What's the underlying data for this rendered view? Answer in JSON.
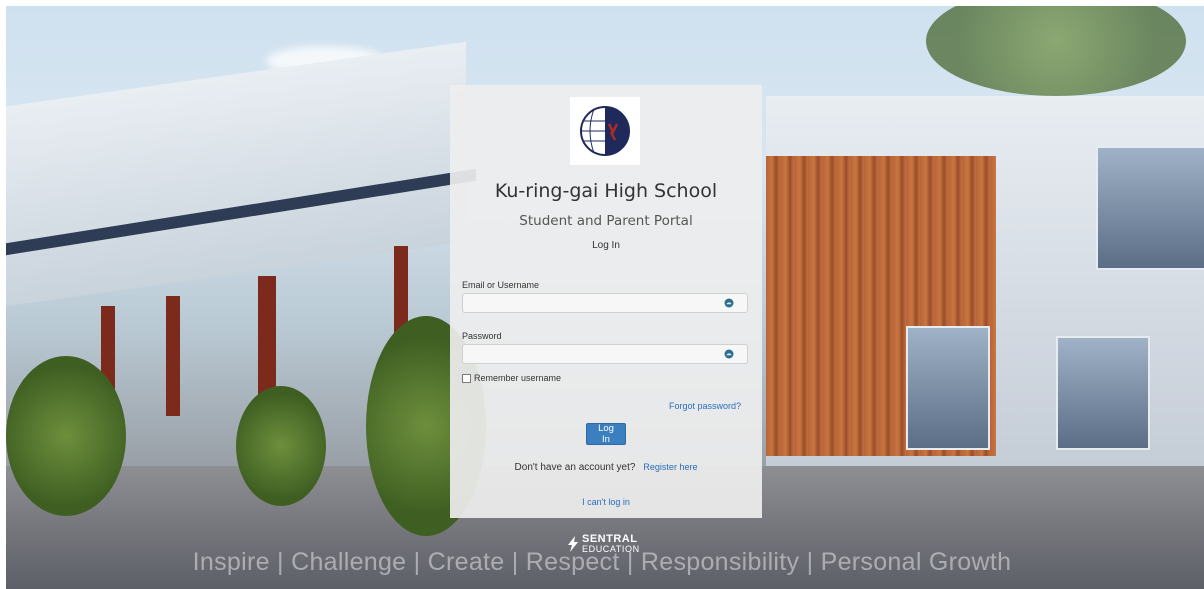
{
  "school_name": "Ku-ring-gai High School",
  "portal_title": "Student and Parent Portal",
  "login_heading": "Log In",
  "form": {
    "username_label": "Email or Username",
    "username_value": "",
    "password_label": "Password",
    "password_value": "",
    "remember_label": "Remember username",
    "forgot_password": "Forgot password?",
    "login_button": "Log In",
    "no_account_text": "Don't have an account yet?",
    "register_link": "Register here",
    "cant_login": "I can't log in"
  },
  "branding": {
    "vendor_line1": "SENTRAL",
    "vendor_line2": "EDUCATION",
    "motto": "Inspire | Challenge | Create | Respect | Responsibility | Personal Growth"
  },
  "colors": {
    "link": "#2a6ebb",
    "button": "#3c7fc1",
    "logo_navy": "#1f2a5a",
    "logo_red": "#b02a2a"
  },
  "icons": {
    "username_field_icon": "password-manager-icon",
    "password_field_icon": "password-manager-icon"
  }
}
